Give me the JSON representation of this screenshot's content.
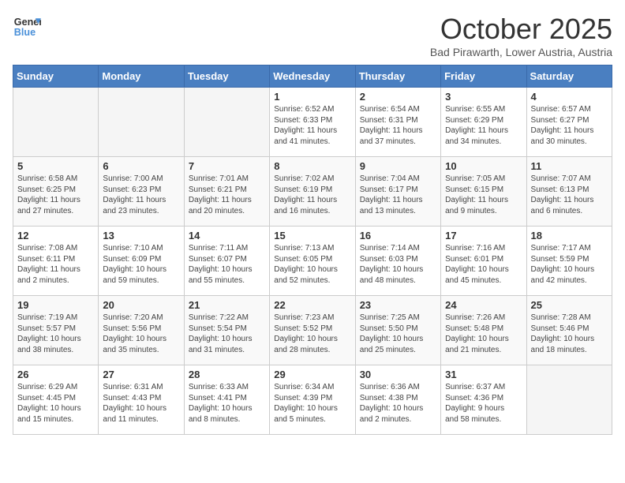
{
  "header": {
    "logo_line1": "General",
    "logo_line2": "Blue",
    "title": "October 2025",
    "subtitle": "Bad Pirawarth, Lower Austria, Austria"
  },
  "days_of_week": [
    "Sunday",
    "Monday",
    "Tuesday",
    "Wednesday",
    "Thursday",
    "Friday",
    "Saturday"
  ],
  "weeks": [
    [
      {
        "day": "",
        "info": ""
      },
      {
        "day": "",
        "info": ""
      },
      {
        "day": "",
        "info": ""
      },
      {
        "day": "1",
        "info": "Sunrise: 6:52 AM\nSunset: 6:33 PM\nDaylight: 11 hours\nand 41 minutes."
      },
      {
        "day": "2",
        "info": "Sunrise: 6:54 AM\nSunset: 6:31 PM\nDaylight: 11 hours\nand 37 minutes."
      },
      {
        "day": "3",
        "info": "Sunrise: 6:55 AM\nSunset: 6:29 PM\nDaylight: 11 hours\nand 34 minutes."
      },
      {
        "day": "4",
        "info": "Sunrise: 6:57 AM\nSunset: 6:27 PM\nDaylight: 11 hours\nand 30 minutes."
      }
    ],
    [
      {
        "day": "5",
        "info": "Sunrise: 6:58 AM\nSunset: 6:25 PM\nDaylight: 11 hours\nand 27 minutes."
      },
      {
        "day": "6",
        "info": "Sunrise: 7:00 AM\nSunset: 6:23 PM\nDaylight: 11 hours\nand 23 minutes."
      },
      {
        "day": "7",
        "info": "Sunrise: 7:01 AM\nSunset: 6:21 PM\nDaylight: 11 hours\nand 20 minutes."
      },
      {
        "day": "8",
        "info": "Sunrise: 7:02 AM\nSunset: 6:19 PM\nDaylight: 11 hours\nand 16 minutes."
      },
      {
        "day": "9",
        "info": "Sunrise: 7:04 AM\nSunset: 6:17 PM\nDaylight: 11 hours\nand 13 minutes."
      },
      {
        "day": "10",
        "info": "Sunrise: 7:05 AM\nSunset: 6:15 PM\nDaylight: 11 hours\nand 9 minutes."
      },
      {
        "day": "11",
        "info": "Sunrise: 7:07 AM\nSunset: 6:13 PM\nDaylight: 11 hours\nand 6 minutes."
      }
    ],
    [
      {
        "day": "12",
        "info": "Sunrise: 7:08 AM\nSunset: 6:11 PM\nDaylight: 11 hours\nand 2 minutes."
      },
      {
        "day": "13",
        "info": "Sunrise: 7:10 AM\nSunset: 6:09 PM\nDaylight: 10 hours\nand 59 minutes."
      },
      {
        "day": "14",
        "info": "Sunrise: 7:11 AM\nSunset: 6:07 PM\nDaylight: 10 hours\nand 55 minutes."
      },
      {
        "day": "15",
        "info": "Sunrise: 7:13 AM\nSunset: 6:05 PM\nDaylight: 10 hours\nand 52 minutes."
      },
      {
        "day": "16",
        "info": "Sunrise: 7:14 AM\nSunset: 6:03 PM\nDaylight: 10 hours\nand 48 minutes."
      },
      {
        "day": "17",
        "info": "Sunrise: 7:16 AM\nSunset: 6:01 PM\nDaylight: 10 hours\nand 45 minutes."
      },
      {
        "day": "18",
        "info": "Sunrise: 7:17 AM\nSunset: 5:59 PM\nDaylight: 10 hours\nand 42 minutes."
      }
    ],
    [
      {
        "day": "19",
        "info": "Sunrise: 7:19 AM\nSunset: 5:57 PM\nDaylight: 10 hours\nand 38 minutes."
      },
      {
        "day": "20",
        "info": "Sunrise: 7:20 AM\nSunset: 5:56 PM\nDaylight: 10 hours\nand 35 minutes."
      },
      {
        "day": "21",
        "info": "Sunrise: 7:22 AM\nSunset: 5:54 PM\nDaylight: 10 hours\nand 31 minutes."
      },
      {
        "day": "22",
        "info": "Sunrise: 7:23 AM\nSunset: 5:52 PM\nDaylight: 10 hours\nand 28 minutes."
      },
      {
        "day": "23",
        "info": "Sunrise: 7:25 AM\nSunset: 5:50 PM\nDaylight: 10 hours\nand 25 minutes."
      },
      {
        "day": "24",
        "info": "Sunrise: 7:26 AM\nSunset: 5:48 PM\nDaylight: 10 hours\nand 21 minutes."
      },
      {
        "day": "25",
        "info": "Sunrise: 7:28 AM\nSunset: 5:46 PM\nDaylight: 10 hours\nand 18 minutes."
      }
    ],
    [
      {
        "day": "26",
        "info": "Sunrise: 6:29 AM\nSunset: 4:45 PM\nDaylight: 10 hours\nand 15 minutes."
      },
      {
        "day": "27",
        "info": "Sunrise: 6:31 AM\nSunset: 4:43 PM\nDaylight: 10 hours\nand 11 minutes."
      },
      {
        "day": "28",
        "info": "Sunrise: 6:33 AM\nSunset: 4:41 PM\nDaylight: 10 hours\nand 8 minutes."
      },
      {
        "day": "29",
        "info": "Sunrise: 6:34 AM\nSunset: 4:39 PM\nDaylight: 10 hours\nand 5 minutes."
      },
      {
        "day": "30",
        "info": "Sunrise: 6:36 AM\nSunset: 4:38 PM\nDaylight: 10 hours\nand 2 minutes."
      },
      {
        "day": "31",
        "info": "Sunrise: 6:37 AM\nSunset: 4:36 PM\nDaylight: 9 hours\nand 58 minutes."
      },
      {
        "day": "",
        "info": ""
      }
    ]
  ]
}
